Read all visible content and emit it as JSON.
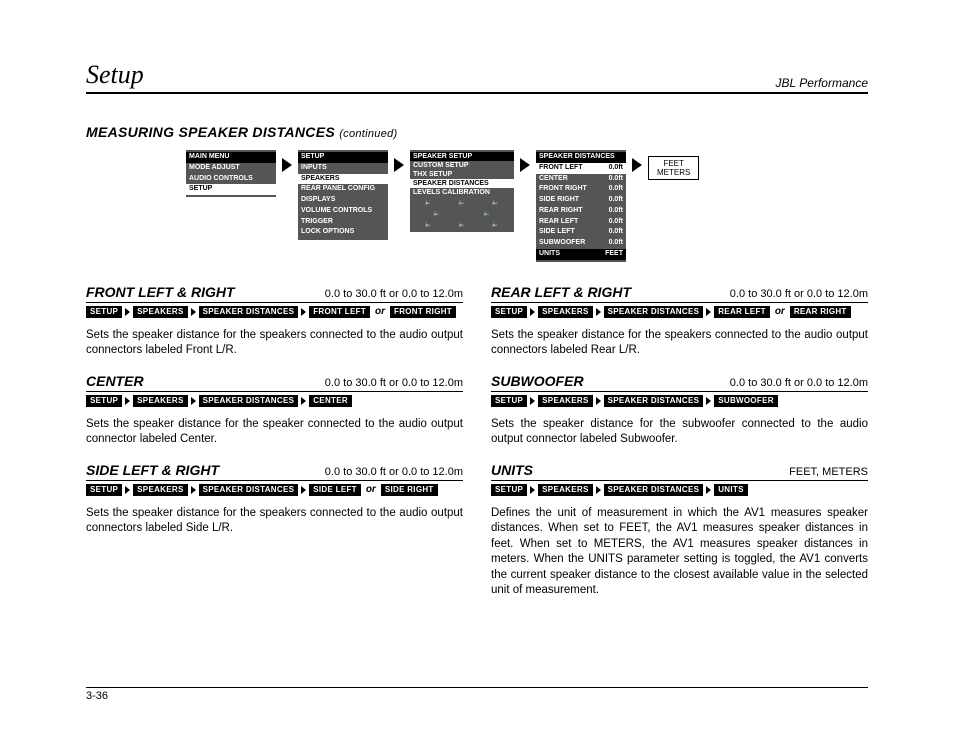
{
  "header": {
    "left": "Setup",
    "right": "JBL Performance"
  },
  "section_title": {
    "main": "MEASURING SPEAKER DISTANCES",
    "cont": "(continued)"
  },
  "menus": {
    "main": {
      "hdr": "MAIN MENU",
      "items": [
        "MODE ADJUST",
        "AUDIO CONTROLS",
        "SETUP"
      ],
      "sel": 2
    },
    "setup": {
      "hdr": "SETUP",
      "items": [
        "INPUTS",
        "SPEAKERS",
        "REAR PANEL CONFIG",
        "DISPLAYS",
        "VOLUME CONTROLS",
        "TRIGGER",
        "LOCK OPTIONS"
      ],
      "sel": 1
    },
    "speaker_setup": {
      "hdr": "SPEAKER SETUP",
      "items": [
        "CUSTOM SETUP",
        "THX SETUP",
        "SPEAKER DISTANCES",
        "LEVELS CALIBRATION"
      ],
      "sel": 2
    },
    "distances": {
      "hdr": "SPEAKER DISTANCES",
      "rows": [
        {
          "l": "FRONT LEFT",
          "v": "0.0ft"
        },
        {
          "l": "CENTER",
          "v": "0.0ft"
        },
        {
          "l": "FRONT RIGHT",
          "v": "0.0ft"
        },
        {
          "l": "SIDE RIGHT",
          "v": "0.0ft"
        },
        {
          "l": "REAR RIGHT",
          "v": "0.0ft"
        },
        {
          "l": "REAR LEFT",
          "v": "0.0ft"
        },
        {
          "l": "SIDE LEFT",
          "v": "0.0ft"
        },
        {
          "l": "SUBWOOFER",
          "v": "0.0ft"
        }
      ],
      "units_row": {
        "l": "UNITS",
        "v": "FEET"
      }
    },
    "units_box": {
      "line1": "FEET",
      "line2": "METERS"
    }
  },
  "params": {
    "front": {
      "name": "FRONT LEFT & RIGHT",
      "range": "0.0 to 30.0 ft or 0.0 to 12.0m",
      "crumbs": [
        "SETUP",
        "SPEAKERS",
        "SPEAKER DISTANCES",
        "FRONT LEFT"
      ],
      "or_crumb": "FRONT RIGHT",
      "body": "Sets the speaker distance for the speakers connected to the audio output connectors labeled Front L/R."
    },
    "center": {
      "name": "CENTER",
      "range": "0.0 to 30.0 ft or 0.0 to 12.0m",
      "crumbs": [
        "SETUP",
        "SPEAKERS",
        "SPEAKER DISTANCES",
        "CENTER"
      ],
      "body": "Sets the speaker distance for the speaker connected to the audio output connector labeled Center."
    },
    "side": {
      "name": "SIDE LEFT & RIGHT",
      "range": "0.0 to 30.0 ft or 0.0 to 12.0m",
      "crumbs": [
        "SETUP",
        "SPEAKERS",
        "SPEAKER DISTANCES",
        "SIDE LEFT"
      ],
      "or_crumb": "SIDE RIGHT",
      "body": "Sets the speaker distance for the speakers connected to the audio output connectors labeled Side L/R."
    },
    "rear": {
      "name": "REAR LEFT & RIGHT",
      "range": "0.0 to 30.0 ft or 0.0 to 12.0m",
      "crumbs": [
        "SETUP",
        "SPEAKERS",
        "SPEAKER DISTANCES",
        "REAR LEFT"
      ],
      "or_crumb": "REAR RIGHT",
      "body": "Sets the speaker distance for the speakers connected to the audio output connectors labeled Rear L/R."
    },
    "sub": {
      "name": "SUBWOOFER",
      "range": "0.0 to 30.0 ft or 0.0 to 12.0m",
      "crumbs": [
        "SETUP",
        "SPEAKERS",
        "SPEAKER DISTANCES",
        "SUBWOOFER"
      ],
      "body": "Sets the speaker distance for the subwoofer connected to the audio output connector labeled Subwoofer."
    },
    "units": {
      "name": "UNITS",
      "range": "FEET, METERS",
      "crumbs": [
        "SETUP",
        "SPEAKERS",
        "SPEAKER DISTANCES",
        "UNITS"
      ],
      "body": "Defines the unit of measurement in which the AV1 measures speaker distances. When set to FEET, the AV1 measures speaker distances in feet. When set to METERS, the AV1 measures speaker distances in meters. When the UNITS parameter setting is toggled, the AV1 converts the current speaker distance to the closest available value in the selected unit of measurement."
    }
  },
  "or_label": "or",
  "footer": "3-36"
}
